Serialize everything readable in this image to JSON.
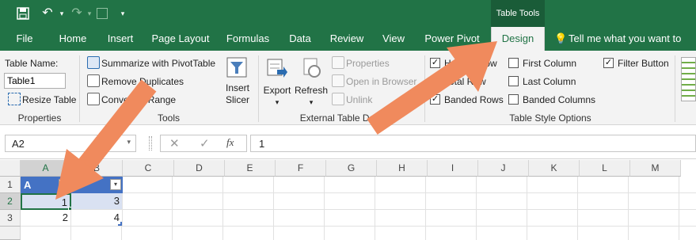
{
  "title_bar": {
    "table_tools": "Table Tools"
  },
  "tabs": [
    "File",
    "Home",
    "Insert",
    "Page Layout",
    "Formulas",
    "Data",
    "Review",
    "View",
    "Power Pivot",
    "Design"
  ],
  "tell_me": "Tell me what you want to do",
  "properties": {
    "table_name_label": "Table Name:",
    "table_name_value": "Table1",
    "resize_label": "Resize Table",
    "group_label": "Properties"
  },
  "tools": {
    "summarize": "Summarize with PivotTable",
    "remove_dup": "Remove Duplicates",
    "convert": "Convert to Range",
    "insert_slicer": "Insert\nSlicer",
    "group_label": "Tools"
  },
  "external": {
    "export": "Export",
    "refresh": "Refresh",
    "properties": "Properties",
    "open_browser": "Open in Browser",
    "unlink": "Unlink",
    "group_label": "External Table Data"
  },
  "style_options": {
    "header_row": "Header Row",
    "total_row": "Total Row",
    "banded_rows": "Banded Rows",
    "first_column": "First Column",
    "last_column": "Last Column",
    "banded_columns": "Banded Columns",
    "filter_button": "Filter Button",
    "group_label": "Table Style Options"
  },
  "formula_bar": {
    "name_box": "A2",
    "fx": "fx",
    "value": "1"
  },
  "grid": {
    "columns": [
      "A",
      "B",
      "C",
      "D",
      "E",
      "F",
      "G",
      "H",
      "I",
      "J",
      "K",
      "L",
      "M"
    ],
    "rows": [
      "1",
      "2",
      "3"
    ],
    "header_a": "A",
    "header_b": "B",
    "r2": [
      "1",
      "3"
    ],
    "r3": [
      "2",
      "4"
    ]
  },
  "colors": {
    "brand": "#217346",
    "arrow": "#f08a5d",
    "table_header": "#4472c4",
    "table_band": "#d9e1f2"
  }
}
